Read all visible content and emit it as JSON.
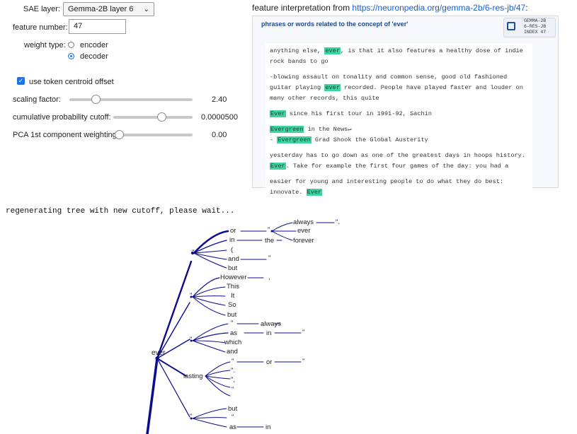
{
  "controls": {
    "sae_layer_label": "SAE layer:",
    "sae_layer_value": "Gemma-2B layer 6",
    "feature_number_label": "feature number:",
    "feature_number_value": "47",
    "weight_type_label": "weight type:",
    "encoder_label": "encoder",
    "decoder_label": "decoder",
    "weight_type_selected": "decoder",
    "centroid_label": "use token centroid offset",
    "centroid_checked": true,
    "sliders": [
      {
        "label": "scaling factor:",
        "value": "2.40"
      },
      {
        "label": "cumulative probability cutoff:",
        "value": "0.0000500"
      },
      {
        "label": "PCA 1st component weighting",
        "value": "0.00"
      }
    ]
  },
  "interpretation": {
    "heading_prefix": "feature interpretation from ",
    "link_text": "https://neuronpedia.org/gemma-2b/6-res-jb/47",
    "heading_suffix": ":",
    "panel_title": "phrases or words related to the concept of 'ever'",
    "badge_line1": "GEMMA-2B",
    "badge_line2": "6-RES-JB",
    "badge_line3": "INDEX 47",
    "snippets": [
      {
        "pre": "anything else, ",
        "hl": "ever",
        "post": ", is that it also features a healthy dose of indie rock bands to go"
      },
      {
        "pre": "-blowing assault on tonality and common sense, good old fashioned guitar playing ",
        "hl": "ever",
        "post": " recorded. People have played faster and louder on many other records, this quite"
      },
      {
        "pre": "",
        "hl": "Ever",
        "post": " since his first tour in 1991-92, Sachin"
      },
      {
        "pre": "",
        "hl": "Evergreen",
        "post": " in the News↵",
        "pre2": "- ",
        "hl2": "Evergreen",
        "post2": " Grad Shook the Global Austerity"
      },
      {
        "pre": "yesterday has to go down as one of the greatest days in hoops history. ",
        "hl": "Ever",
        "post": ". Take for example the first four games of the day: you had a"
      },
      {
        "pre": "easier for young and interesting people to do what they do best: innovate. ",
        "hl": "Ever",
        "post": ""
      }
    ]
  },
  "status_text": "regenerating tree with new cutoff, please wait...",
  "tree": {
    "root": "ever",
    "nodes": [
      "or",
      "in",
      "(",
      "and",
      "but",
      "However",
      "This",
      "It",
      "So",
      "but",
      "\"",
      "as",
      "which",
      "and",
      "\"",
      "\".",
      "\",",
      "\"",
      "lasting",
      "but",
      "\"",
      "as",
      "\"",
      "\"",
      "\"",
      "\"",
      "\"",
      "the",
      "always",
      "ever",
      "forever",
      "\".",
      "\"",
      ",",
      "always",
      "in",
      "\"",
      "or",
      "\"",
      "in",
      "\""
    ]
  },
  "colors": {
    "accent": "#1a73e8",
    "tree": "#0b0b8f",
    "highlight": "#3fd3a0"
  }
}
